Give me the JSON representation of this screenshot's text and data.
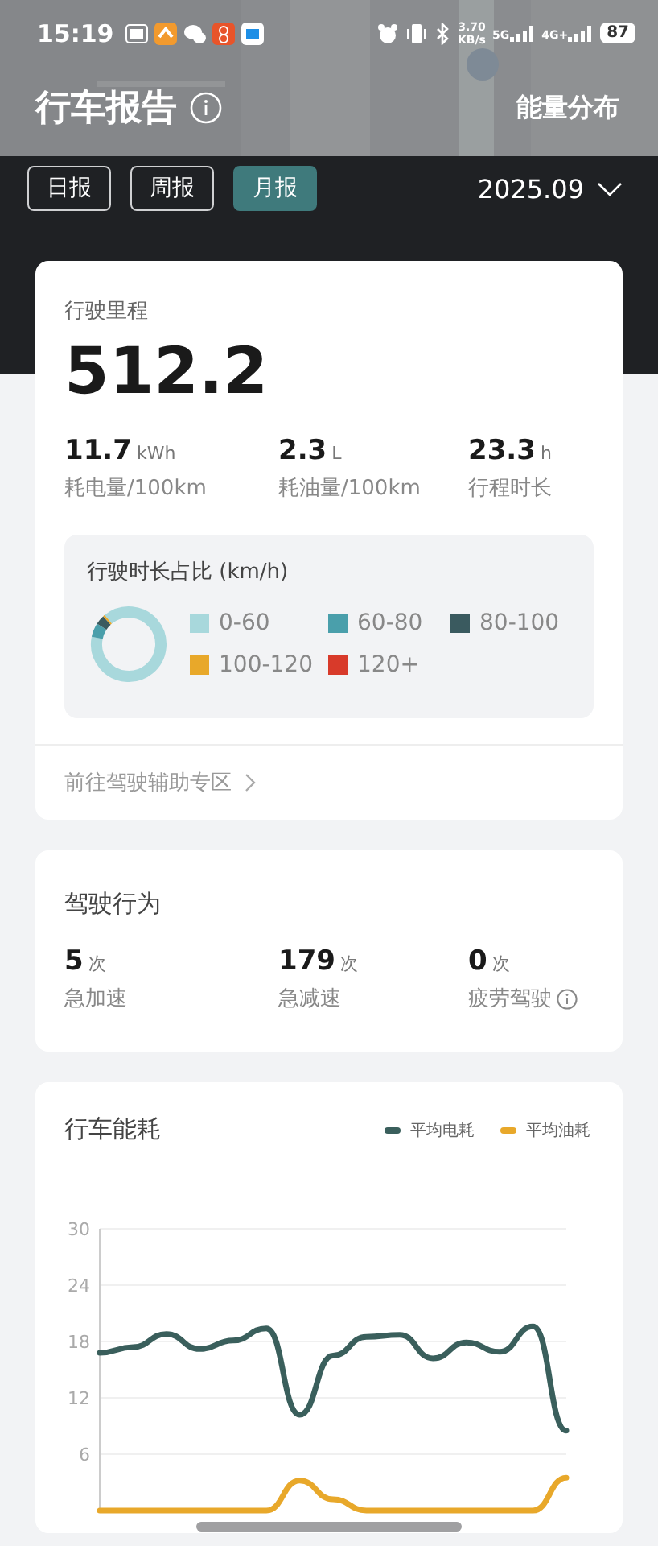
{
  "status_bar": {
    "time": "15:19",
    "speed": "3.70",
    "speed_unit": "KB/s",
    "network_1": "5G",
    "network_2": "4G+",
    "battery": "87"
  },
  "header": {
    "title": "行车报告",
    "right_link": "能量分布"
  },
  "tabs": [
    {
      "label": "日报",
      "selected": false
    },
    {
      "label": "周报",
      "selected": false
    },
    {
      "label": "月报",
      "selected": true
    }
  ],
  "month_picker": {
    "value": "2025.09"
  },
  "mileage_card": {
    "label": "行驶里程",
    "value": "512.2",
    "stats": [
      {
        "value": "11.7",
        "unit": "kWh",
        "label": "耗电量/100km"
      },
      {
        "value": "2.3",
        "unit": "L",
        "label": "耗油量/100km"
      },
      {
        "value": "23.3",
        "unit": "h",
        "label": "行程时长"
      }
    ],
    "speed_share": {
      "title": "行驶时长占比 (km/h)",
      "legend": [
        {
          "label": "0-60",
          "color": "#a8d8dc"
        },
        {
          "label": "60-80",
          "color": "#4a9fab"
        },
        {
          "label": "80-100",
          "color": "#3a5a5f"
        },
        {
          "label": "100-120",
          "color": "#e8a82a"
        },
        {
          "label": "120+",
          "color": "#d83a2a"
        }
      ]
    },
    "link": "前往驾驶辅助专区"
  },
  "behavior_card": {
    "title": "驾驶行为",
    "items": [
      {
        "value": "5",
        "unit": "次",
        "label": "急加速",
        "info": false
      },
      {
        "value": "179",
        "unit": "次",
        "label": "急减速",
        "info": false
      },
      {
        "value": "0",
        "unit": "次",
        "label": "疲劳驾驶",
        "info": true
      }
    ]
  },
  "energy_card": {
    "title": "行车能耗",
    "chart_data": {
      "type": "line",
      "grid": true,
      "ylim": [
        0,
        30
      ],
      "yticks": [
        6,
        12,
        18,
        24,
        30
      ],
      "series": [
        {
          "name": "平均电耗",
          "color": "#3a5f5c",
          "values": [
            16.8,
            17.4,
            18.8,
            17.2,
            18.1,
            19.4,
            10.2,
            16.5,
            18.5,
            18.7,
            16.2,
            17.9,
            16.9,
            19.6,
            8.5
          ]
        },
        {
          "name": "平均油耗",
          "color": "#e8a82a",
          "values": [
            0,
            0,
            0,
            0,
            0,
            0,
            3.2,
            1.2,
            0,
            0,
            0,
            0,
            0,
            0,
            3.5
          ]
        }
      ]
    }
  }
}
